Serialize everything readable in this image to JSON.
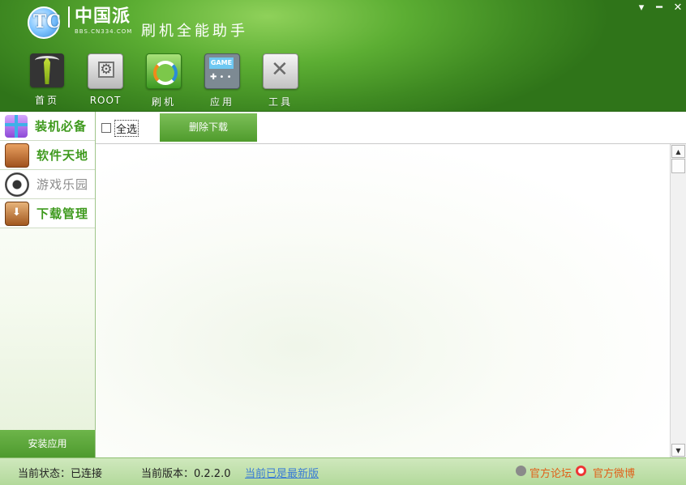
{
  "header": {
    "brand_name": "中国派",
    "brand_url": "BBS.CN334.COM",
    "logo_mark": "TC",
    "app_title": "刷机全能助手",
    "minimize_glyph": "▾",
    "maximize_glyph": "━",
    "close_glyph": "✕"
  },
  "nav": {
    "items": [
      {
        "label": "首页",
        "icon": "home-tie-icon"
      },
      {
        "label": "ROOT",
        "icon": "root-gear-icon"
      },
      {
        "label": "刷机",
        "icon": "flash-refresh-icon"
      },
      {
        "label": "应用",
        "icon": "game-device-icon"
      },
      {
        "label": "工具",
        "icon": "tools-icon"
      }
    ]
  },
  "sidebar": {
    "items": [
      {
        "label": "装机必备",
        "icon": "gift-box-icon"
      },
      {
        "label": "软件天地",
        "icon": "briefcase-icon"
      },
      {
        "label": "游戏乐园",
        "icon": "soccer-ball-icon"
      },
      {
        "label": "下载管理",
        "icon": "download-box-icon"
      }
    ],
    "install_button": "安装应用"
  },
  "toolbar": {
    "select_all_label": "全选",
    "delete_download_label": "删除下载"
  },
  "status": {
    "state": "当前状态：已连接",
    "version": "当前版本：0.2.2.0",
    "update_status": "当前已是最新版",
    "forum": "官方论坛",
    "weibo": "官方微博"
  },
  "colors": {
    "accent_green": "#4e9a2e",
    "link_blue": "#3a7bd5",
    "orange": "#e0611a"
  }
}
